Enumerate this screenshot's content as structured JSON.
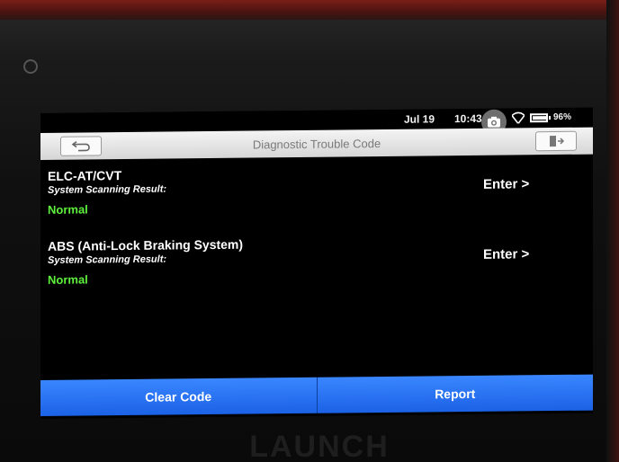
{
  "status_bar": {
    "date": "Jul 19",
    "time": "10:43",
    "battery": "96%"
  },
  "title_bar": {
    "title": "Diagnostic Trouble Code",
    "back_icon": "back-arrow-icon",
    "exit_icon": "exit-door-icon"
  },
  "systems": [
    {
      "name": "ELC-AT/CVT",
      "result_label": "System Scanning Result:",
      "result": "Normal",
      "enter_label": "Enter >"
    },
    {
      "name": "ABS (Anti-Lock Braking System)",
      "result_label": "System Scanning Result:",
      "result": "Normal",
      "enter_label": "Enter >"
    }
  ],
  "actions": {
    "clear_code": "Clear Code",
    "report": "Report"
  },
  "device": {
    "brand": "LAUNCH"
  },
  "colors": {
    "accent_blue": "#2a74f5",
    "status_normal": "#5ef03c",
    "device_red": "#7a1e18"
  }
}
